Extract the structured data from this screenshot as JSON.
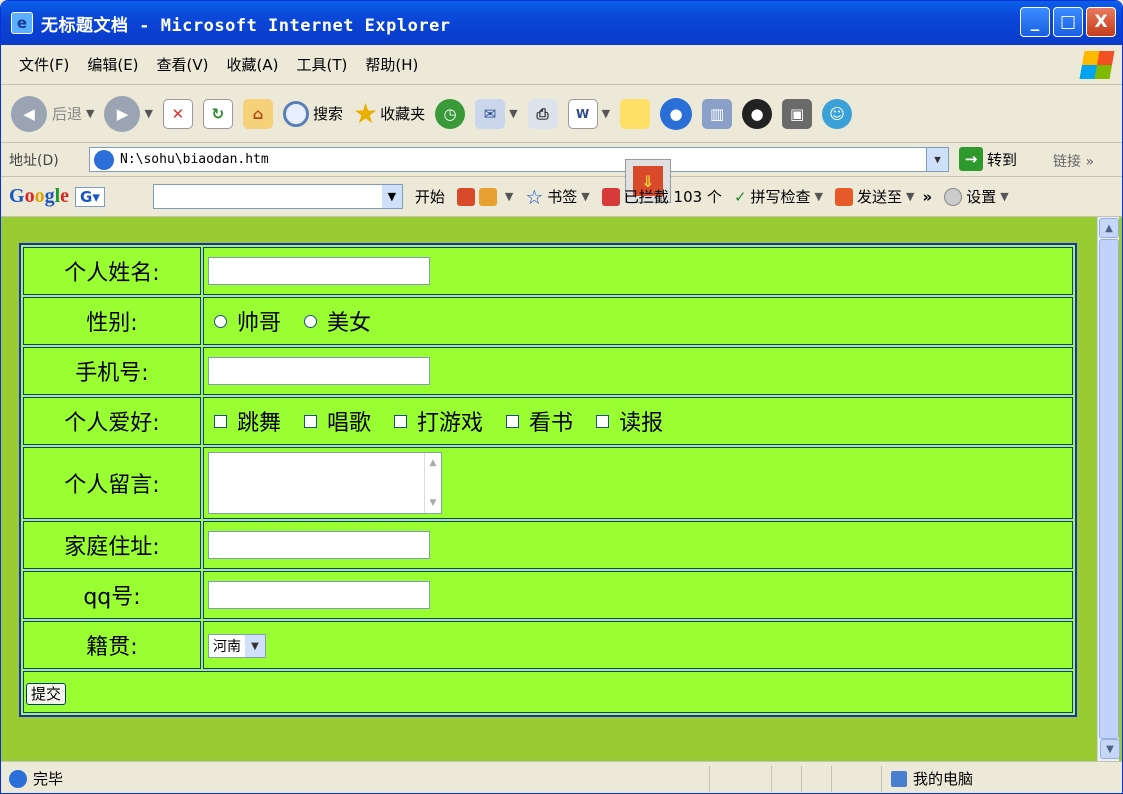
{
  "window": {
    "title": "无标题文档 - Microsoft Internet Explorer",
    "minimize": "_",
    "maximize": "□",
    "close": "X"
  },
  "menu": [
    "文件(F)",
    "编辑(E)",
    "查看(V)",
    "收藏(A)",
    "工具(T)",
    "帮助(H)"
  ],
  "toolbar": {
    "back": "后退",
    "search": "搜索",
    "favorites": "收藏夹"
  },
  "address": {
    "label": "地址(D)",
    "value": "N:\\sohu\\biaodan.htm",
    "go": "转到",
    "links": "链接"
  },
  "googlebar": {
    "start": "开始",
    "bookmarks": "书签",
    "blocked": "已拦截 103 个",
    "spellcheck": "拼写检查",
    "sendto": "发送至",
    "settings": "设置"
  },
  "form": {
    "name_label": "个人姓名:",
    "name_value": "",
    "gender_label": "性别:",
    "gender_options": [
      "帅哥",
      "美女"
    ],
    "phone_label": "手机号:",
    "phone_value": "",
    "hobby_label": "个人爱好:",
    "hobby_options": [
      "跳舞",
      "唱歌",
      "打游戏",
      "看书",
      "读报"
    ],
    "message_label": "个人留言:",
    "message_value": "",
    "address_label": "家庭住址:",
    "address_value": "",
    "qq_label": "qq号:",
    "qq_value": "",
    "origin_label": "籍贯:",
    "origin_selected": "河南",
    "submit": "提交"
  },
  "status": {
    "text": "完毕",
    "zone": "我的电脑"
  },
  "colors": {
    "page_bg": "#99cc33",
    "table_bg": "#99ff33",
    "table_border": "#1a2acc"
  }
}
